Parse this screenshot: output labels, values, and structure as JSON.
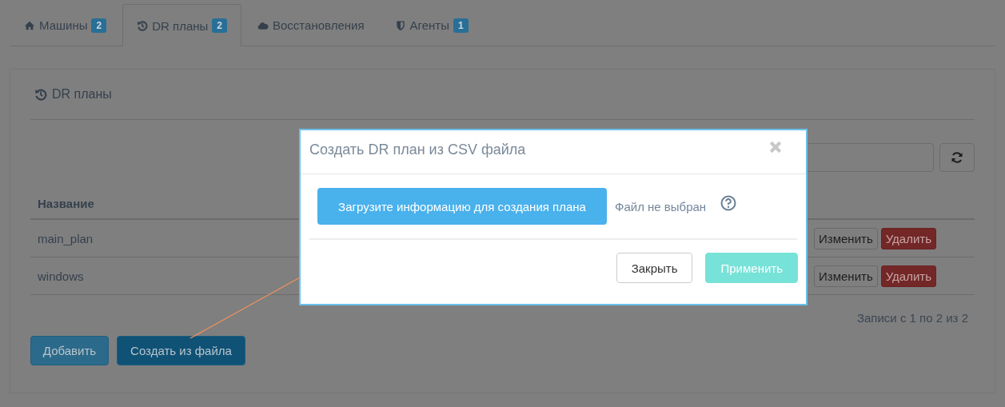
{
  "tabs": [
    {
      "label": "Машины",
      "badge": "2",
      "selected": false
    },
    {
      "label": "DR планы",
      "badge": "2",
      "selected": true
    },
    {
      "label": "Восстановления",
      "selected": false
    },
    {
      "label": "Агенты",
      "badge": "1",
      "selected": false
    }
  ],
  "panel": {
    "title": "DR планы",
    "table": {
      "columns": [
        "Название"
      ],
      "rows": [
        {
          "name": "main_plan",
          "actions": [
            "Изменить",
            "Удалить"
          ]
        },
        {
          "name": "windows",
          "actions": [
            "Изменить",
            "Удалить"
          ]
        }
      ]
    },
    "info": "Записи с 1 по 2 из 2",
    "buttons": [
      "Добавить",
      "Создать из файла"
    ]
  },
  "modal": {
    "title": "Создать DR план из CSV файла",
    "upload_button": "Загрузите информацию для создания плана",
    "file_status": "Файл не выбран",
    "buttons": [
      {
        "label": "Закрыть",
        "kind": "default",
        "disabled": false
      },
      {
        "label": "Применить",
        "kind": "primary",
        "disabled": true
      }
    ]
  }
}
